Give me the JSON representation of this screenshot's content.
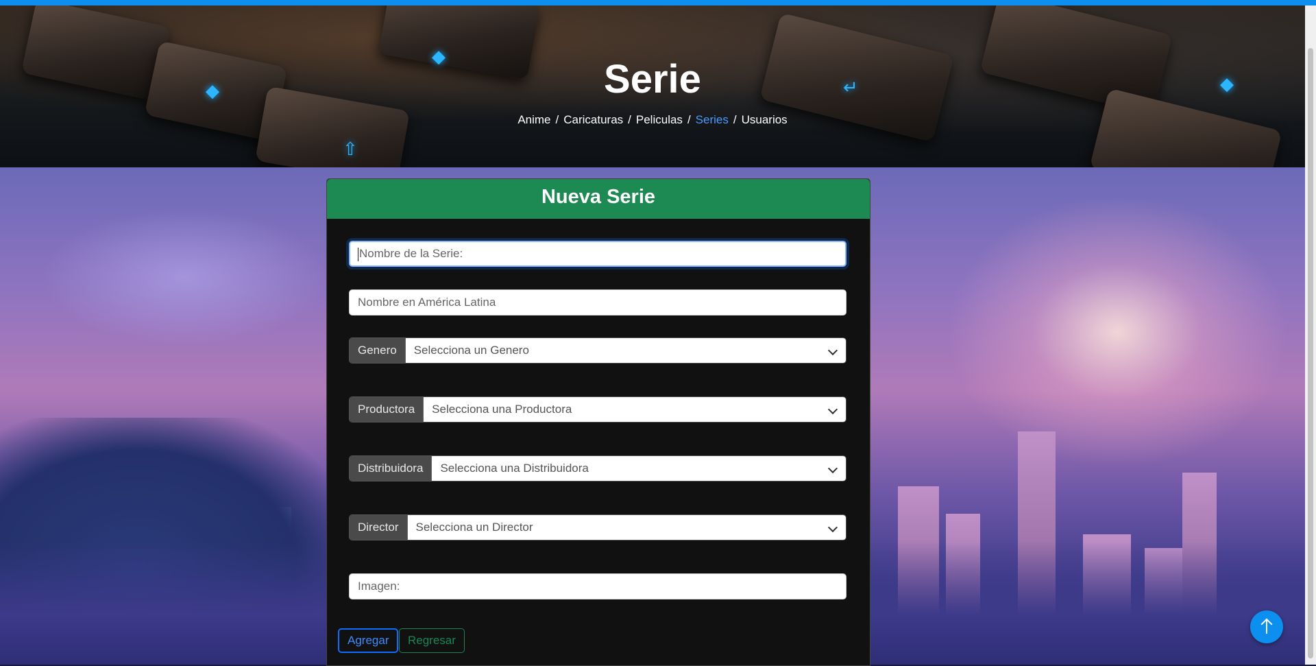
{
  "hero": {
    "title": "Serie",
    "breadcrumb": [
      {
        "label": "Anime",
        "active": false
      },
      {
        "label": "Caricaturas",
        "active": false
      },
      {
        "label": "Peliculas",
        "active": false
      },
      {
        "label": "Series",
        "active": true
      },
      {
        "label": "Usuarios",
        "active": false
      }
    ],
    "separator": "/"
  },
  "form": {
    "header": "Nueva Serie",
    "nombre_placeholder": "Nombre de la Serie:",
    "nombre_latam_placeholder": "Nombre en América Latina",
    "genero": {
      "label": "Genero",
      "selected": "Selecciona un Genero"
    },
    "productora": {
      "label": "Productora",
      "selected": "Selecciona una Productora"
    },
    "distribuidora": {
      "label": "Distribuidora",
      "selected": "Selecciona una Distribuidora"
    },
    "director": {
      "label": "Director",
      "selected": "Selecciona un Director"
    },
    "imagen_placeholder": "Imagen:",
    "submit_label": "Agregar",
    "back_label": "Regresar"
  },
  "colors": {
    "accent": "#0d8ff0",
    "header_green": "#1d8a53",
    "active_link": "#4a9cff"
  },
  "icons": {
    "scroll_top": "arrow-up-icon",
    "select": "chevron-down-icon"
  }
}
